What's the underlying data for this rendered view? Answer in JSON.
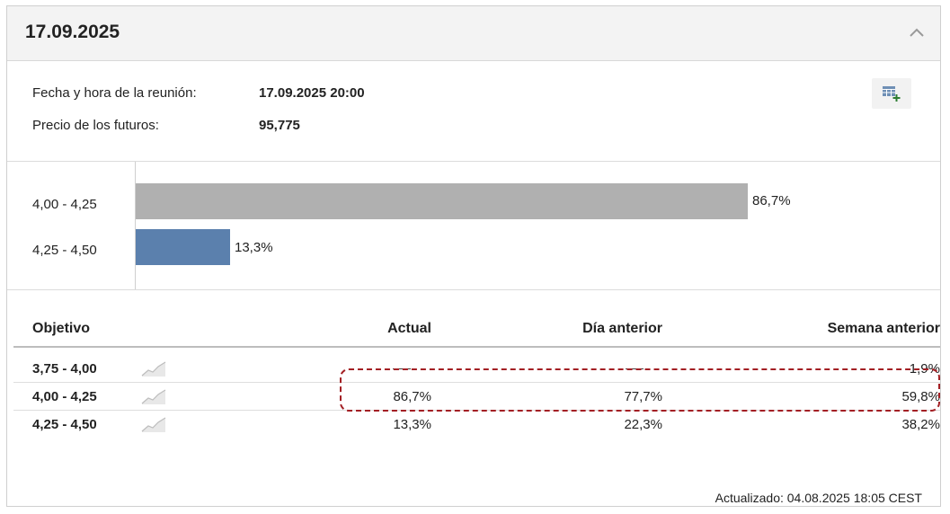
{
  "panel": {
    "title": "17.09.2025",
    "collapse_icon": "chevron-up-icon",
    "export_icon": "table-add-icon"
  },
  "info": {
    "meeting_label": "Fecha y hora de la reunión:",
    "meeting_value": "17.09.2025 20:00",
    "futures_label": "Precio de los futuros:",
    "futures_value": "95,775"
  },
  "bars": [
    {
      "label": "4,00 - 4,25",
      "value": 86.7,
      "value_label": "86,7%",
      "color": "#b0b0b0"
    },
    {
      "label": "4,25 - 4,50",
      "value": 13.3,
      "value_label": "13,3%",
      "color": "#5b80ad"
    }
  ],
  "table": {
    "headers": {
      "target": "Objetivo",
      "current": "Actual",
      "prev_day": "Día anterior",
      "prev_week": "Semana anterior"
    },
    "rows": [
      {
        "target": "3,75 - 4,00",
        "current": "",
        "prev_day": "",
        "prev_week": "1,9%",
        "highlighted": false
      },
      {
        "target": "4,00 - 4,25",
        "current": "86,7%",
        "prev_day": "77,7%",
        "prev_week": "59,8%",
        "highlighted": true
      },
      {
        "target": "4,25 - 4,50",
        "current": "13,3%",
        "prev_day": "22,3%",
        "prev_week": "38,2%",
        "highlighted": false
      }
    ]
  },
  "footer": {
    "updated": "Actualizado: 04.08.2025 18:05 CEST"
  },
  "colors": {
    "highlight_border": "#a31f24",
    "bar_gray": "#b0b0b0",
    "bar_blue": "#5b80ad"
  }
}
